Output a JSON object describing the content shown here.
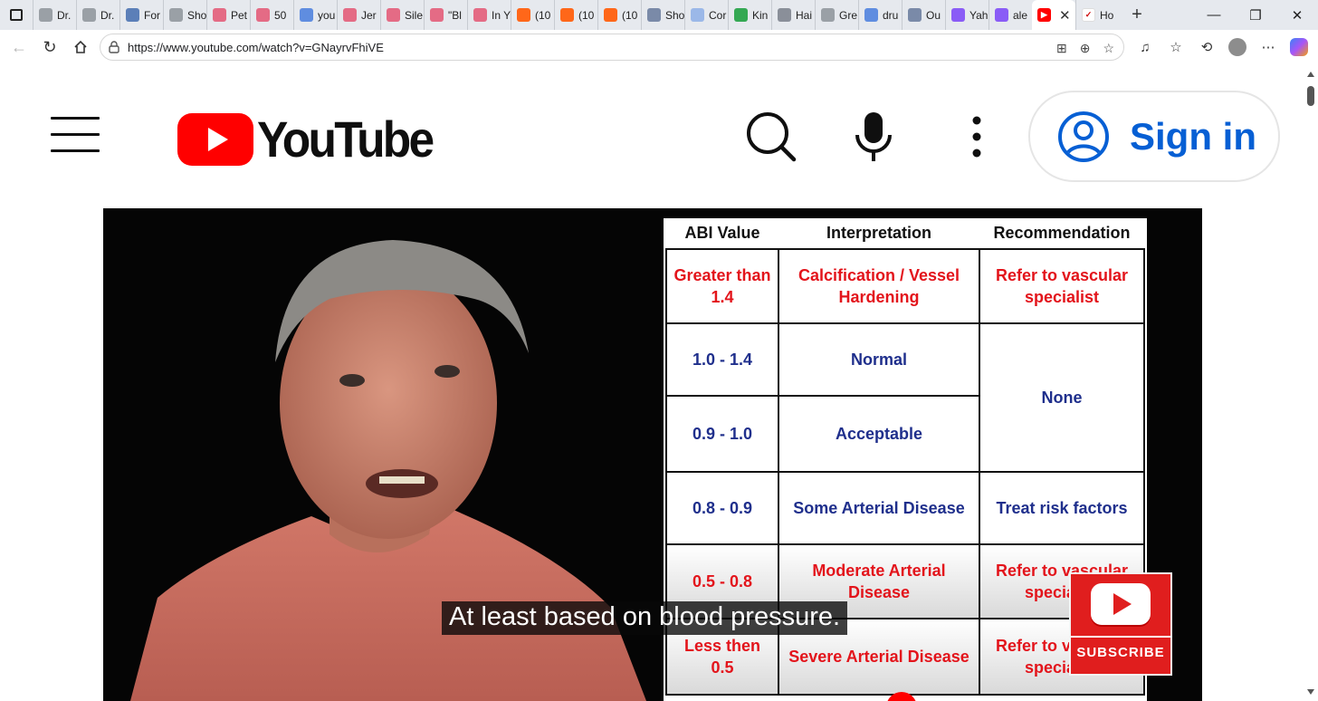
{
  "browser": {
    "tabs": [
      {
        "label": "Dr.",
        "icon": "globe-icon",
        "color": "#9aa0a6"
      },
      {
        "label": "Dr.",
        "icon": "globe-icon",
        "color": "#9aa0a6"
      },
      {
        "label": "For",
        "icon": "document-icon",
        "color": "#5b7fb8"
      },
      {
        "label": "Sho",
        "icon": "globe-icon",
        "color": "#9aa0a6"
      },
      {
        "label": "Pet",
        "icon": "youtube-icon",
        "color": "#e46b85"
      },
      {
        "label": "50",
        "icon": "youtube-icon",
        "color": "#e46b85"
      },
      {
        "label": "you",
        "icon": "search-icon",
        "color": "#5f8de0"
      },
      {
        "label": "Jer",
        "icon": "youtube-icon",
        "color": "#e46b85"
      },
      {
        "label": "Sile",
        "icon": "youtube-icon",
        "color": "#e46b85"
      },
      {
        "label": "\"Bl",
        "icon": "youtube-icon",
        "color": "#e46b85"
      },
      {
        "label": "In Y",
        "icon": "youtube-icon",
        "color": "#e46b85"
      },
      {
        "label": "(10",
        "icon": "substack-icon",
        "color": "#ff6719"
      },
      {
        "label": "(10",
        "icon": "substack-icon",
        "color": "#ff6719"
      },
      {
        "label": "(10",
        "icon": "substack-icon",
        "color": "#ff6719"
      },
      {
        "label": "Sho",
        "icon": "medium-icon",
        "color": "#7a8aa8"
      },
      {
        "label": "Cor",
        "icon": "sparkle-icon",
        "color": "#9bb8e8"
      },
      {
        "label": "Kin",
        "icon": "sheet-icon",
        "color": "#34a853"
      },
      {
        "label": "Hai",
        "icon": "shield-icon",
        "color": "#8a8f99"
      },
      {
        "label": "Gre",
        "icon": "google-icon",
        "color": "#9aa0a6"
      },
      {
        "label": "dru",
        "icon": "search-icon",
        "color": "#5f8de0"
      },
      {
        "label": "Ou",
        "icon": "medium-icon",
        "color": "#7a8aa8"
      },
      {
        "label": "Yah",
        "icon": "yahoo-icon",
        "color": "#8a5cf6"
      },
      {
        "label": "ale",
        "icon": "yahoo-icon",
        "color": "#8a5cf6"
      }
    ],
    "active_tab": {
      "icon": "youtube-icon",
      "close": "✕"
    },
    "last_tab": {
      "label": "Ho",
      "icon": "bird-icon"
    },
    "new_tab": "+",
    "address": {
      "url": "https://www.youtube.com/watch?v=GNayrvFhiVE"
    }
  },
  "youtube": {
    "logo_text": "YouTube",
    "sign_in": "Sign in",
    "accent": "#ff0000",
    "link_blue": "#065fd4"
  },
  "video": {
    "table": {
      "headers": [
        "ABI Value",
        "Interpretation",
        "Recommendation"
      ],
      "r1": {
        "abi": "Greater than 1.4",
        "interp": "Calcification / Vessel Hardening",
        "rec": "Refer to vascular specialist"
      },
      "r2": {
        "abi": "1.0 - 1.4",
        "interp": "Normal"
      },
      "r23_rec": "None",
      "r3": {
        "abi": "0.9 - 1.0",
        "interp": "Acceptable"
      },
      "r4": {
        "abi": "0.8 - 0.9",
        "interp": "Some Arterial Disease",
        "rec": "Treat risk factors"
      },
      "r5": {
        "abi": "0.5 - 0.8",
        "interp": "Moderate Arterial Disease",
        "rec": "Refer to vascular specialist"
      },
      "r6": {
        "abi": "Less then 0.5",
        "interp": "Severe Arterial Disease",
        "rec": "Refer to vascular specialist"
      }
    },
    "caption": "At least based on blood pressure.",
    "subscribe": "SUBSCRIBE"
  }
}
